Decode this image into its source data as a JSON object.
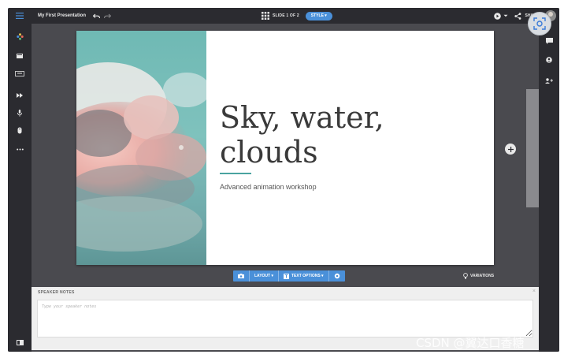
{
  "app": {
    "presentation_title": "My First Presentation",
    "slide_counter": "SLIDE 1 OF 2",
    "style_button": "STYLE ▾",
    "share_label": "SHARE"
  },
  "slide": {
    "title": "Sky, water, clouds",
    "subtitle": "Advanced animation workshop",
    "accent_color": "#4aa3a0"
  },
  "slide_toolbar": {
    "layout_label": "LAYOUT ▾",
    "text_options_label": "TEXT OPTIONS ▾",
    "variations_label": "VARIATIONS"
  },
  "speaker_notes": {
    "header": "SPEAKER NOTES",
    "placeholder": "Type your speaker notes",
    "close_glyph": "×"
  },
  "left_sidebar": {
    "items": [
      "menu-icon",
      "color-palette-icon",
      "slides-icon",
      "caption-icon",
      "forward-icon",
      "microphone-icon",
      "mouse-icon",
      "more-icon",
      "presenter-icon"
    ]
  },
  "right_sidebar": {
    "items": [
      "comment-icon",
      "user-icon",
      "add-user-icon"
    ]
  },
  "colors": {
    "chrome": "#2b2b30",
    "canvas": "#4a4a4f",
    "accent_blue": "#4a90d9"
  },
  "watermark": "CSDN @翼达口香糖"
}
